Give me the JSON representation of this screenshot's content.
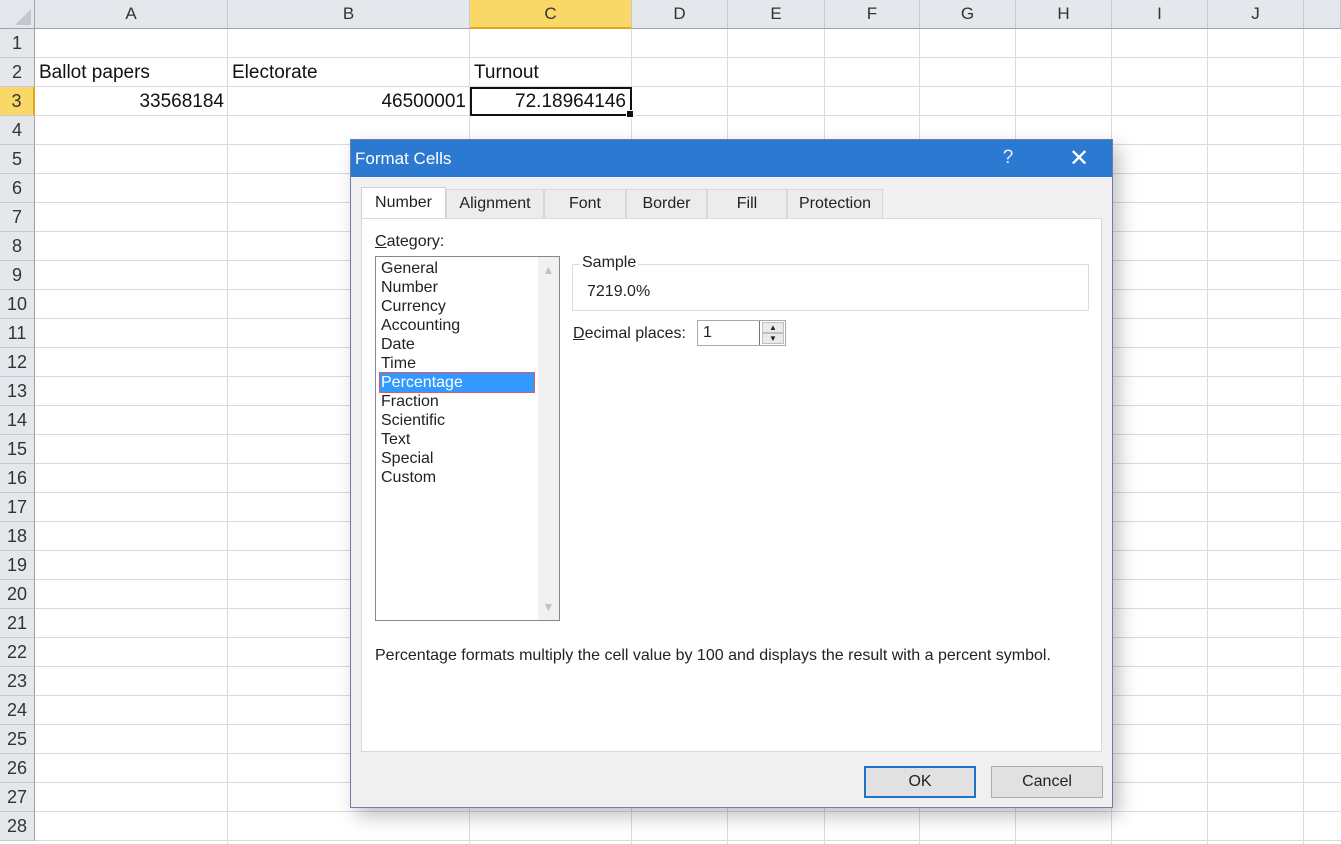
{
  "spreadsheet": {
    "columns": [
      "A",
      "B",
      "C",
      "D",
      "E",
      "F",
      "G",
      "H",
      "I",
      "J"
    ],
    "selected_column": "C",
    "rows": [
      "1",
      "2",
      "3",
      "4",
      "5",
      "6",
      "7",
      "8",
      "9",
      "10",
      "11",
      "12",
      "13",
      "14",
      "15",
      "16",
      "17",
      "18",
      "19",
      "20",
      "21",
      "22",
      "23",
      "24",
      "25",
      "26",
      "27",
      "28"
    ],
    "selected_row": "3",
    "cells": {
      "A2": "Ballot papers",
      "B2": "Electorate",
      "C2": "Turnout",
      "A3": "33568184",
      "B3": "46500001",
      "C3": "72.18964146"
    },
    "active_cell": "C3"
  },
  "dialog": {
    "title": "Format Cells",
    "help_label": "?",
    "close_label": "✕",
    "tabs": [
      {
        "label": "Number",
        "active": true
      },
      {
        "label": "Alignment",
        "active": false
      },
      {
        "label": "Font",
        "active": false
      },
      {
        "label": "Border",
        "active": false
      },
      {
        "label": "Fill",
        "active": false
      },
      {
        "label": "Protection",
        "active": false
      }
    ],
    "category_label_accel": "C",
    "category_label_rest": "ategory:",
    "categories": [
      "General",
      "Number",
      "Currency",
      "Accounting",
      "Date",
      "Time",
      "Percentage",
      "Fraction",
      "Scientific",
      "Text",
      "Special",
      "Custom"
    ],
    "selected_category": "Percentage",
    "scroll_up_icon": "▲",
    "scroll_down_icon": "▼",
    "sample_label": "Sample",
    "sample_value": "7219.0%",
    "decimal_label_accel": "D",
    "decimal_label_rest": "ecimal places:",
    "decimal_places": "1",
    "spin_up_icon": "▲",
    "spin_down_icon": "▼",
    "description": "Percentage formats multiply the cell value by 100 and displays the result with a percent symbol.",
    "ok_label": "OK",
    "cancel_label": "Cancel"
  }
}
